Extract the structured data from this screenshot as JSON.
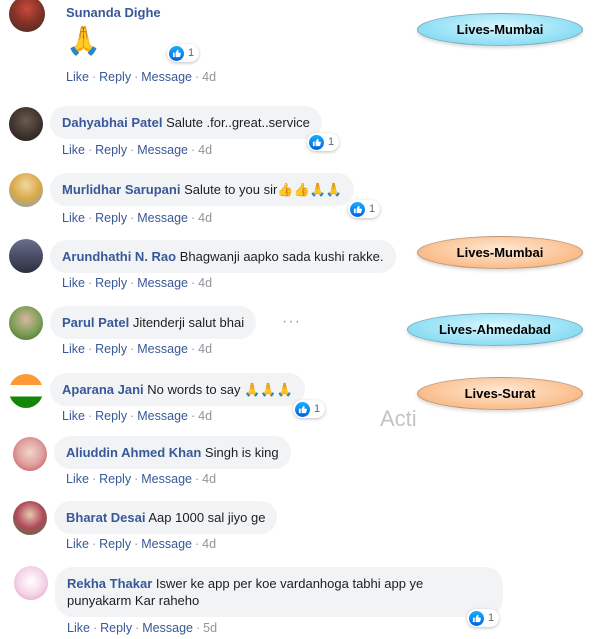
{
  "actions": {
    "like": "Like",
    "reply": "Reply",
    "message": "Message",
    "sep": "·"
  },
  "colors": {
    "name": "#385898",
    "bubble": "#f2f3f5",
    "tag_blue": "#9ce3f7",
    "tag_orange": "#fbc79b",
    "like_blue": "#1877f2"
  },
  "comments": [
    {
      "name": "Sunanda Dighe",
      "text": "🙏",
      "time": "4d",
      "reactions": "1"
    },
    {
      "name": "Dahyabhai Patel",
      "text": "Salute .for..great..service",
      "time": "4d",
      "reactions": "1"
    },
    {
      "name": "Murlidhar Sarupani",
      "text": "Salute to you sir👍👍🙏🙏",
      "time": "4d",
      "reactions": "1"
    },
    {
      "name": "Arundhathi N. Rao",
      "text": "Bhagwanji aapko sada kushi rakke.",
      "time": "4d"
    },
    {
      "name": "Parul Patel",
      "text": "Jitenderji salut bhai",
      "time": "4d"
    },
    {
      "name": "Aparana Jani",
      "text": "No words to say 🙏🙏🙏",
      "time": "4d",
      "reactions": "1"
    },
    {
      "name": "Aliuddin Ahmed Khan",
      "text": "Singh is king",
      "time": "4d"
    },
    {
      "name": "Bharat Desai",
      "text": "Aap 1000 sal jiyo ge",
      "time": "4d"
    },
    {
      "name": "Rekha Thakar",
      "text": "Iswer ke app per koe vardanhoga tabhi app ye punyakarm Kar raheho",
      "time": "5d",
      "reactions": "1"
    }
  ],
  "tags": [
    "Lives-Mumbai",
    "Lives-Mumbai",
    "Lives-Ahmedabad",
    "Lives-Surat"
  ],
  "watermark": "Acti",
  "more_icon": "more-options-icon"
}
